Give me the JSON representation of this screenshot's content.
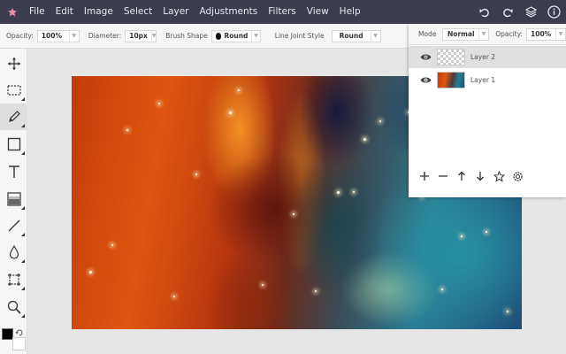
{
  "menubar": {
    "items": [
      "File",
      "Edit",
      "Image",
      "Select",
      "Layer",
      "Adjustments",
      "Filters",
      "View",
      "Help"
    ],
    "right_icons": [
      "undo-icon",
      "redo-icon",
      "layers-icon",
      "info-icon"
    ]
  },
  "options": {
    "opacity_label": "Opacity:",
    "opacity_value": "100%",
    "diameter_label": "Diameter:",
    "diameter_value": "10px",
    "brush_shape_label": "Brush Shape",
    "brush_shape_value": "Round",
    "line_joint_label": "Line Joint Style",
    "line_joint_value": "Round"
  },
  "tools": [
    "move-icon",
    "marquee-select-icon",
    "pencil-icon",
    "rectangle-icon",
    "text-icon",
    "gradient-icon",
    "line-icon",
    "drop-icon",
    "crop-icon",
    "zoom-icon"
  ],
  "active_tool": "pencil-icon",
  "colors": {
    "foreground": "#000000",
    "background": "#ffffff",
    "menubar": "#3b3d4e"
  },
  "layers_panel": {
    "mode_label": "Mode",
    "mode_value": "Normal",
    "opacity_label": "Opacity:",
    "opacity_value": "100%",
    "layers": [
      {
        "name": "Layer 2",
        "selected": true,
        "thumbnail": "transparent"
      },
      {
        "name": "Layer 1",
        "selected": false,
        "thumbnail": "nebula"
      }
    ],
    "actions": [
      "add-layer-icon",
      "remove-layer-icon",
      "move-up-icon",
      "move-down-icon",
      "star-icon",
      "settings-icon"
    ]
  }
}
